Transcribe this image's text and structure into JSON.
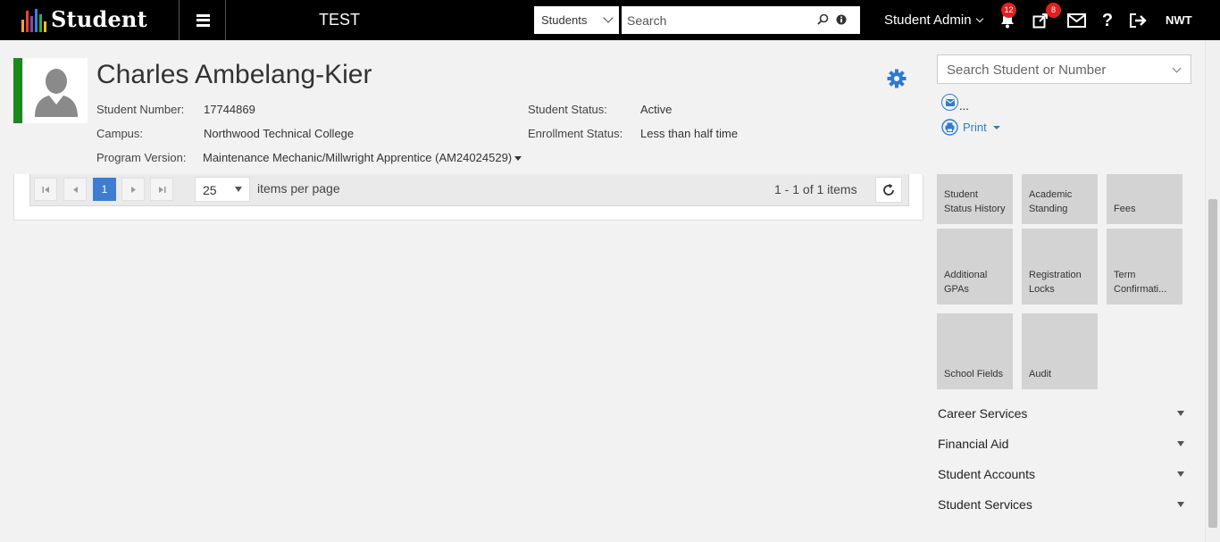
{
  "topbar": {
    "logo_text": "Student",
    "logo_bar_colors": [
      "#f5a623",
      "#e8452c",
      "#8e44ad",
      "#2e86de",
      "#27ae60",
      "#f1c40f"
    ],
    "env_title": "TEST",
    "search_scope": "Students",
    "search_placeholder": "Search",
    "user_name": "Student Admin",
    "notifications_count": "12",
    "tasks_count": "8",
    "help_label": "?",
    "org_code": "NWT"
  },
  "student": {
    "name": "Charles Ambelang-Kier",
    "status_color": "#1a8a1a",
    "number_label": "Student Number:",
    "number": "17744869",
    "campus_label": "Campus:",
    "campus": "Northwood Technical College",
    "program_label": "Program Version:",
    "program": "Maintenance Mechanic/Millwright Apprentice (AM24024529)",
    "status_label": "Student Status:",
    "status": "Active",
    "enrollment_label": "Enrollment Status:",
    "enrollment": "Less than half time"
  },
  "grid": {
    "current_page": "1",
    "page_size": "25",
    "per_page_label": "items per page",
    "items_summary": "1 - 1 of 1 items"
  },
  "right_panel": {
    "search_placeholder": "Search Student or Number",
    "mail_more": "...",
    "print_label": "Print",
    "tiles": [
      {
        "label": "Student Status History"
      },
      {
        "label": "Academic Standing"
      },
      {
        "label": "Fees"
      },
      {
        "label": "Additional GPAs"
      },
      {
        "label": "Registration Locks"
      },
      {
        "label": "Term Confirmati..."
      },
      {
        "label": "School Fields"
      },
      {
        "label": "Audit"
      }
    ],
    "sections": [
      {
        "label": "Career Services"
      },
      {
        "label": "Financial Aid"
      },
      {
        "label": "Student Accounts"
      },
      {
        "label": "Student Services"
      }
    ]
  },
  "accent_color": "#2e7bcf"
}
